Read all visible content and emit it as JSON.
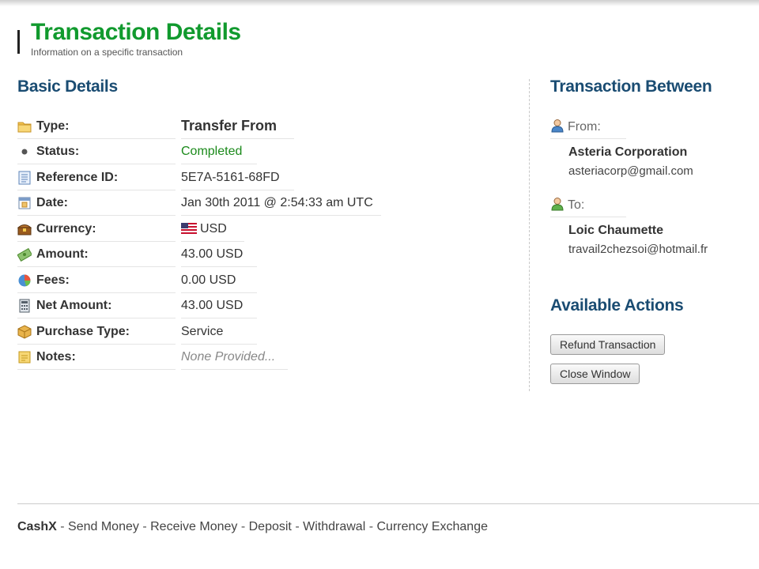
{
  "header": {
    "title": "Transaction Details",
    "subtitle": "Information on a specific transaction"
  },
  "basic": {
    "title": "Basic Details",
    "rows": [
      {
        "label": "Type:",
        "value": "Transfer From",
        "icon": "folder-icon"
      },
      {
        "label": "Status:",
        "value": "Completed",
        "icon": "bullet-icon"
      },
      {
        "label": "Reference ID:",
        "value": "5E7A-5161-68FD",
        "icon": "document-icon"
      },
      {
        "label": "Date:",
        "value": "Jan 30th 2011 @ 2:54:33 am UTC",
        "icon": "calendar-icon"
      },
      {
        "label": "Currency:",
        "value": "USD",
        "icon": "treasure-chest-icon",
        "flag": "us-flag-icon"
      },
      {
        "label": "Amount:",
        "value": "43.00 USD",
        "icon": "money-icon"
      },
      {
        "label": "Fees:",
        "value": "0.00 USD",
        "icon": "pie-chart-icon"
      },
      {
        "label": "Net Amount:",
        "value": "43.00 USD",
        "icon": "calculator-icon"
      },
      {
        "label": "Purchase Type:",
        "value": "Service",
        "icon": "box-icon"
      },
      {
        "label": "Notes:",
        "value": "None Provided...",
        "icon": "note-icon"
      }
    ]
  },
  "between": {
    "title": "Transaction Between",
    "from_label": "From:",
    "from_name": "Asteria Corporation",
    "from_email": "asteriacorp@gmail.com",
    "to_label": "To:",
    "to_name": "Loic Chaumette",
    "to_email": "travail2chezsoi@hotmail.fr"
  },
  "actions": {
    "title": "Available Actions",
    "refund_label": "Refund Transaction",
    "close_label": "Close Window"
  },
  "footer": {
    "brand": "CashX",
    "links": [
      "Send Money",
      "Receive Money",
      "Deposit",
      "Withdrawal",
      "Currency Exchange"
    ]
  },
  "colors": {
    "title_green": "#119a2e",
    "section_blue": "#1a4c72",
    "status_green": "#1b8a1b"
  }
}
